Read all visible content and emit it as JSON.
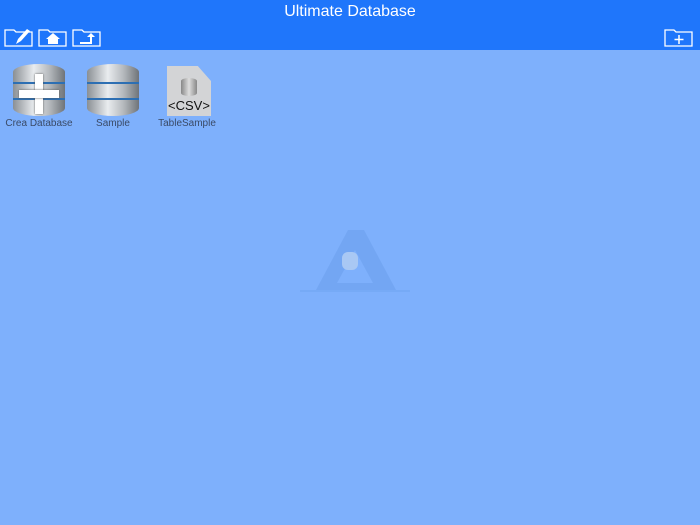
{
  "header": {
    "title": "Ultimate Database"
  },
  "toolbar": {
    "edit": "edit-folder-icon",
    "home": "home-folder-icon",
    "up": "up-folder-icon",
    "new": "new-folder-icon"
  },
  "items": [
    {
      "label": "Crea Database"
    },
    {
      "label": "Sample"
    },
    {
      "label": "TableSample",
      "badge": "<CSV>"
    }
  ]
}
